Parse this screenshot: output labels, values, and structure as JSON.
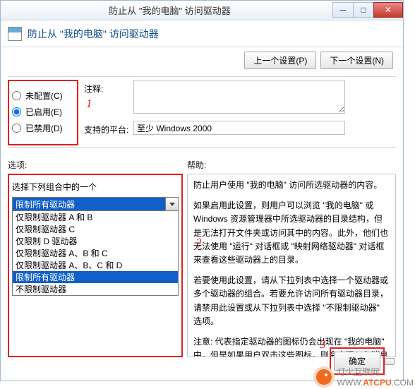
{
  "window": {
    "title": "防止从 \"我的电脑\" 访问驱动器",
    "header_text": "防止从 \"我的电脑\" 访问驱动器"
  },
  "nav": {
    "prev": "上一个设置(P)",
    "next": "下一个设置(N)"
  },
  "config": {
    "radio_not_configured": "未配置(C)",
    "radio_enabled": "已启用(E)",
    "radio_disabled": "已禁用(D)",
    "selected": "enabled",
    "comment_label": "注释:",
    "platform_label": "支持的平台:",
    "platform_value": "至少 Windows 2000"
  },
  "annotations": {
    "a1": "1",
    "a2": "2",
    "a3": "3"
  },
  "options": {
    "label": "选项:",
    "prompt": "选择下列组合中的一个",
    "selected": "限制所有驱动器",
    "items": [
      "仅限制驱动器 A 和 B",
      "仅限制驱动器 C",
      "仅限制 D 驱动器",
      "仅限制驱动器 A、B 和 C",
      "仅限制驱动器 A、B、C 和 D",
      "限制所有驱动器",
      "不限制驱动器"
    ]
  },
  "help": {
    "label": "帮助:",
    "p1": "防止用户使用 \"我的电脑\" 访问所选驱动器的内容。",
    "p2": "如果启用此设置，则用户可以浏览 \"我的电脑\" 或 Windows 资源管理器中所选驱动器的目录结构，但是无法打开文件夹或访问其中的内容。此外，他们也无法使用 \"运行\" 对话框或 \"映射网络驱动器\" 对话框来查看这些驱动器上的目录。",
    "p3": "若要使用此设置，请从下拉列表中选择一个驱动器或多个驱动器的组合。若要允许访问所有驱动器目录，请禁用此设置或从下拉列表中选择 \"不限制驱动器\" 选项。",
    "p4": "注意: 代表指定驱动器的图标仍会出现在 \"我的电脑\" 中，但是如果用户双击这些图标，则会出现一条消息来解释设置防止这一操作。"
  },
  "footer": {
    "ok": "确定"
  },
  "watermark": {
    "text1": "灯火互联网",
    "text2": "WWW.",
    "text3": "ATCPU",
    "text4": ".COM"
  }
}
